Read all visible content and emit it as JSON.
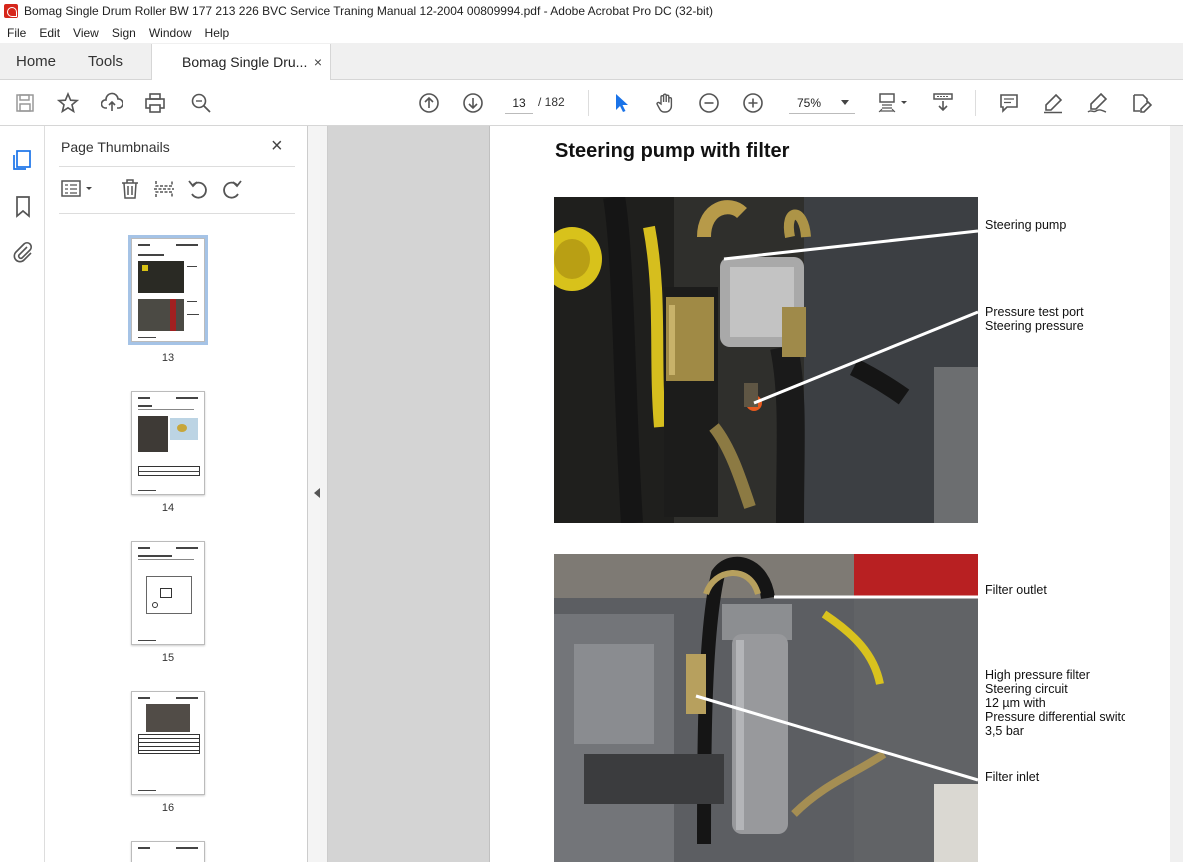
{
  "window": {
    "title": "Bomag Single Drum Roller BW 177 213 226 BVC Service Traning Manual 12-2004 00809994.pdf - Adobe Acrobat Pro DC (32-bit)"
  },
  "menu": [
    "File",
    "Edit",
    "View",
    "Sign",
    "Window",
    "Help"
  ],
  "tabs": {
    "home": "Home",
    "tools": "Tools",
    "document": "Bomag Single Dru...",
    "close": "×"
  },
  "toolbar": {
    "current_page": "13",
    "page_total": "/ 182",
    "zoom": "75%",
    "icons": [
      "save-icon",
      "star-icon",
      "upload-icon",
      "print-icon",
      "find-icon",
      "page-up-icon",
      "page-down-icon",
      "select-arrow-icon",
      "hand-icon",
      "zoom-out-icon",
      "zoom-in-icon",
      "fit-page-icon",
      "scroll-mode-icon",
      "comment-icon",
      "highlight-icon",
      "sign-icon",
      "edit-icon"
    ]
  },
  "panel": {
    "title": "Page Thumbnails",
    "close": "×",
    "thumbnails": [
      {
        "page": "13",
        "selected": true
      },
      {
        "page": "14",
        "selected": false
      },
      {
        "page": "15",
        "selected": false
      },
      {
        "page": "16",
        "selected": false
      }
    ]
  },
  "document": {
    "heading": "Steering pump with filter",
    "callouts_photo1": [
      "Steering pump",
      "Pressure test port\nSteering pressure"
    ],
    "callouts_photo2": [
      "Filter outlet",
      "High pressure filter\nSteering circuit\n12 µm with\nPressure differential switc\n3,5 bar",
      "Filter inlet"
    ]
  },
  "colors": {
    "acrobat_red": "#d6261b",
    "viewer_bg": "#d4d4d4",
    "select_blue": "#1a73e8"
  }
}
